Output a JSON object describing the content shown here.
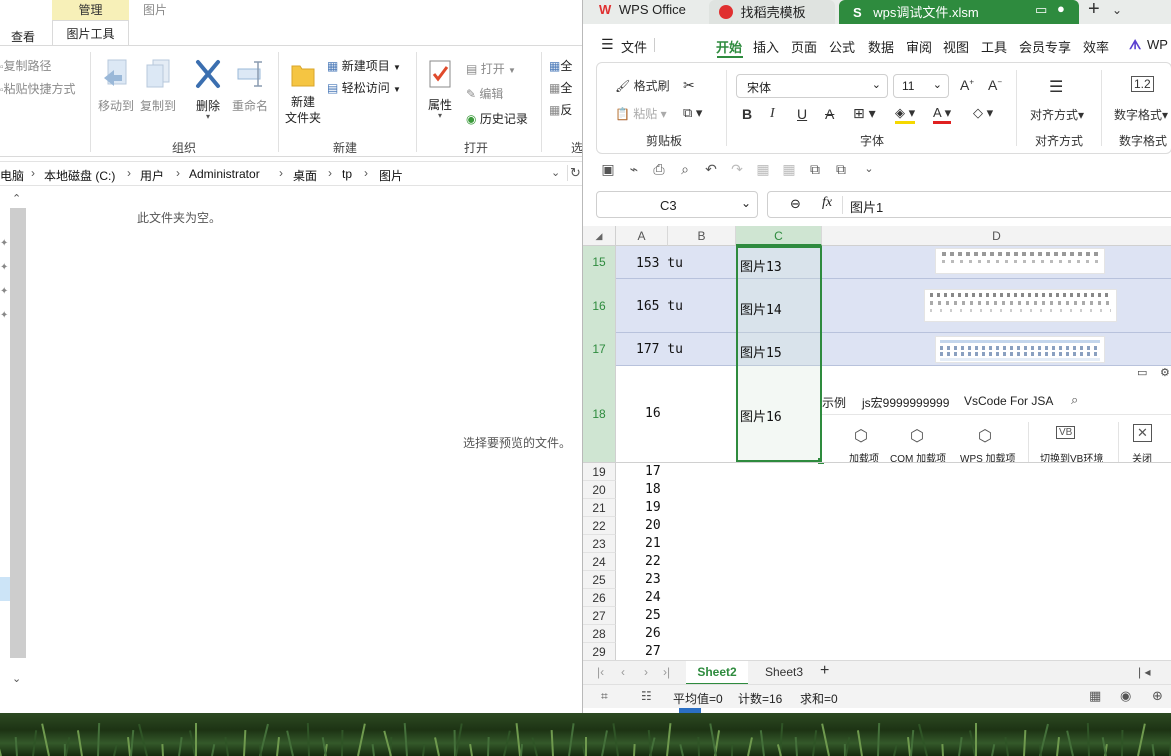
{
  "explorer": {
    "tabs": {
      "manage": "管理",
      "picture": "图片",
      "view": "查看",
      "picture_tools": "图片工具"
    },
    "ribbon": {
      "copy_path": "复制路径",
      "paste_shortcut": "粘贴快捷方式",
      "move_to": "移动到",
      "copy_to": "复制到",
      "delete": "删除",
      "rename": "重命名",
      "new_folder_l1": "新建",
      "new_folder_l2": "文件夹",
      "new_item": "新建项目",
      "easy_access": "轻松访问",
      "properties": "属性",
      "open": "打开",
      "edit": "编辑",
      "history": "历史记录",
      "select_all": "全",
      "select_none": "全",
      "invert": "反",
      "groups": {
        "organize": "组织",
        "new": "新建",
        "open": "打开",
        "select": "选"
      }
    },
    "address": [
      "电脑",
      "本地磁盘 (C:)",
      "用户",
      "Administrator",
      "桌面",
      "tp",
      "图片"
    ],
    "empty_message": "此文件夹为空。",
    "preview_message": "选择要预览的文件。"
  },
  "wps": {
    "titlebar": {
      "app": "WPS Office",
      "template": "找稻壳模板",
      "file": "wps调试文件.xlsm"
    },
    "menu": [
      "文件",
      "开始",
      "插入",
      "页面",
      "公式",
      "数据",
      "审阅",
      "视图",
      "工具",
      "会员专享",
      "效率",
      "WP"
    ],
    "ribbon": {
      "format_painter": "格式刷",
      "paste": "粘贴",
      "clipboard": "剪贴板",
      "font_name": "宋体",
      "font_size": "11",
      "font_group": "字体",
      "align": "对齐方式",
      "align_group": "对齐方式",
      "numfmt": "数字格式",
      "numfmt_group": "数字格式"
    },
    "name_box": "C3",
    "formula": "图片1",
    "columns": [
      "A",
      "B",
      "C",
      "D"
    ],
    "big_rows": [
      {
        "row": "15",
        "a": "153 tu",
        "c": "图片13"
      },
      {
        "row": "16",
        "a": "165 tu",
        "c": "图片14"
      },
      {
        "row": "17",
        "a": "177 tu",
        "c": "图片15"
      },
      {
        "row": "18",
        "a": "16",
        "c": "图片16"
      }
    ],
    "small_rows": [
      {
        "row": "19",
        "a": "17"
      },
      {
        "row": "20",
        "a": "18"
      },
      {
        "row": "21",
        "a": "19"
      },
      {
        "row": "22",
        "a": "20"
      },
      {
        "row": "23",
        "a": "21"
      },
      {
        "row": "24",
        "a": "22"
      },
      {
        "row": "25",
        "a": "23"
      },
      {
        "row": "26",
        "a": "24"
      },
      {
        "row": "27",
        "a": "25"
      },
      {
        "row": "28",
        "a": "26"
      },
      {
        "row": "29",
        "a": "27"
      }
    ],
    "embedded_toolbar": {
      "labels": [
        "示例",
        "js宏9999999999",
        "VsCode For JSA"
      ],
      "buttons": [
        "加载项",
        "COM 加载项",
        "WPS 加载项",
        "切换到VB环境",
        "关闭"
      ]
    },
    "sheets": [
      "Sheet2",
      "Sheet3"
    ],
    "active_sheet": "Sheet2",
    "status": {
      "average": "平均值=0",
      "count": "计数=16",
      "sum": "求和=0"
    },
    "accent": "#2e8b3e"
  }
}
